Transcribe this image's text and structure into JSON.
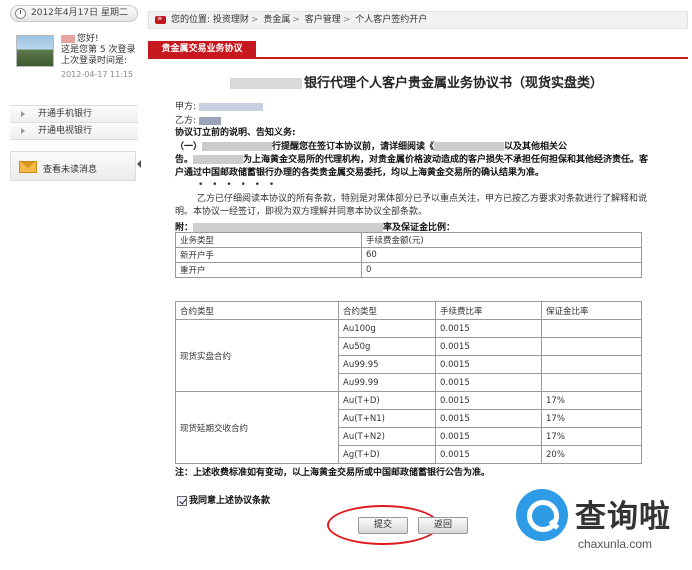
{
  "header": {
    "date": "2012年4月17日 星期二"
  },
  "user": {
    "greeting": "您好!",
    "login_count": "这是您第 5 次登录",
    "last_login_label": "上次登录时间是:",
    "last_login_time": "2012-04-17 11:15"
  },
  "side_menu": {
    "items": [
      {
        "label": "开通手机银行"
      },
      {
        "label": "开通电视银行"
      }
    ],
    "messages_label": "查看未读消息"
  },
  "breadcrumb": {
    "prefix": "您的位置:",
    "items": [
      "投资理财",
      "贵金属",
      "客户管理",
      "个人客户签约开户"
    ]
  },
  "tab": {
    "label": "贵金属交易业务协议"
  },
  "document": {
    "title_suffix": "银行代理个人客户贵金属业务协议书（现货实盘类）",
    "party_a_label": "甲方:",
    "party_b_label": "乙方:",
    "notice_head": "协议订立前的说明、告知义务:",
    "notice_1a": "（一）",
    "notice_1b": "行提醒您在签订本协议前，请详细阅读《",
    "notice_1c": "以及其他相关公",
    "notice_1d": "告。",
    "notice_1e": "为上海黄金交易所的代理机构，对贵金属价格波动造成的客户损失不承担任何担保和其他经济责任。客户通过中国邮政储蓄银行办理的各类贵金属交易委托，均以上海黄金交易所的确认结果为准。",
    "dots": "• • • • • •",
    "notice_2": "乙方已仔细阅读本协议的所有条款，特别是对黑体部分已予以重点关注，甲方已按乙方要求对条款进行了解释和说明。本协议一经签订，即视为双方理解并同意本协议全部条款。",
    "attach_prefix": "附：",
    "attach_suffix": "率及保证金比例：",
    "footnote": "注：上述收费标准如有变动，以上海黄金交易所或中国邮政储蓄银行公告为准。",
    "agree_label": "我同意上述协议条款"
  },
  "fee_table": {
    "headers": [
      "业务类型",
      "手续费金额(元)"
    ],
    "rows": [
      [
        "新开户手",
        "60"
      ],
      [
        "重开户",
        "0"
      ]
    ]
  },
  "rate_table": {
    "headers": [
      "合约类型",
      "合约类型",
      "手续费比率",
      "保证金比率"
    ],
    "groups": [
      {
        "name": "现货实盘合约",
        "rows": [
          [
            "Au100g",
            "0.0015",
            ""
          ],
          [
            "Au50g",
            "0.0015",
            ""
          ],
          [
            "Au99.95",
            "0.0015",
            ""
          ],
          [
            "Au99.99",
            "0.0015",
            ""
          ]
        ]
      },
      {
        "name": "现货延期交收合约",
        "rows": [
          [
            "Au(T+D)",
            "0.0015",
            "17%"
          ],
          [
            "Au(T+N1)",
            "0.0015",
            "17%"
          ],
          [
            "Au(T+N2)",
            "0.0015",
            "17%"
          ],
          [
            "Ag(T+D)",
            "0.0015",
            "20%"
          ]
        ]
      }
    ]
  },
  "buttons": {
    "submit": "提交",
    "back": "返回"
  },
  "watermark": {
    "cn": "查询啦",
    "en": "chaxunla.com"
  },
  "colors": {
    "brand_red": "#c8181f",
    "annotation_red": "#e0191f",
    "watermark_blue": "#2e9be6"
  }
}
